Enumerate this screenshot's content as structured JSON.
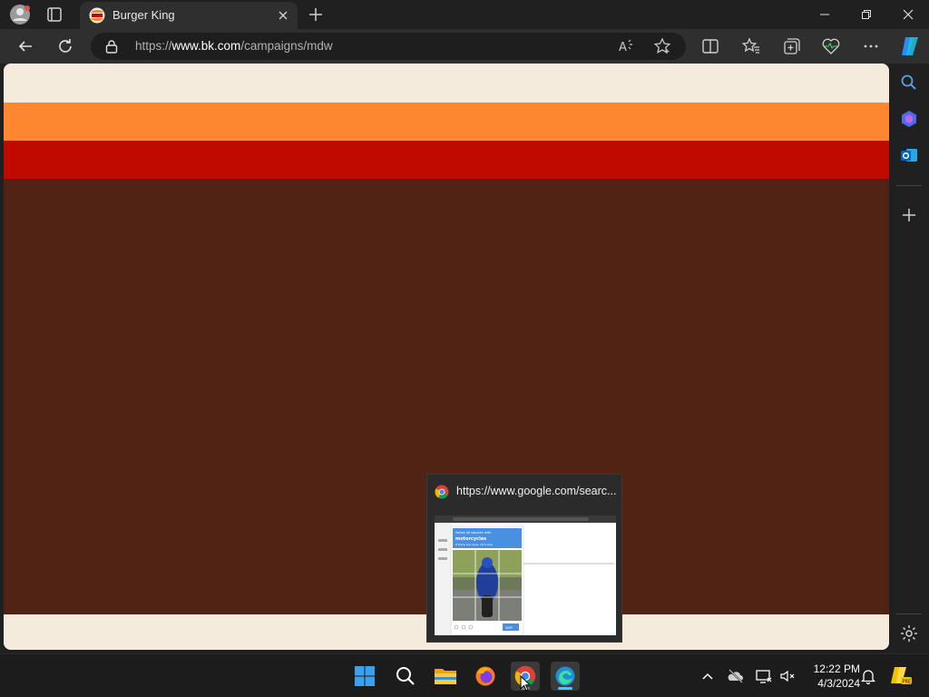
{
  "browser": {
    "tab": {
      "title": "Burger King"
    },
    "address": {
      "scheme": "https://",
      "host": "www.bk.com",
      "path": "/campaigns/mdw"
    }
  },
  "page": {
    "colors": {
      "cream": "#f5ebdc",
      "orange": "#ff8732",
      "red": "#c00a00",
      "brown": "#502314"
    }
  },
  "taskbar": {
    "apps": [
      "start-icon",
      "search-icon",
      "file-explorer-icon",
      "firefox-icon",
      "chrome-icon",
      "edge-icon"
    ],
    "clock": {
      "time": "12:22 PM",
      "date": "4/3/2024"
    },
    "preview": {
      "title": "https://www.google.com/searc..."
    }
  },
  "thumbnail": {
    "captcha_header_line1": "Select all squares with",
    "captcha_header_keyword": "motorcycles",
    "captcha_header_line3": "If there are none, click skip",
    "captcha_button": "SKIP"
  }
}
